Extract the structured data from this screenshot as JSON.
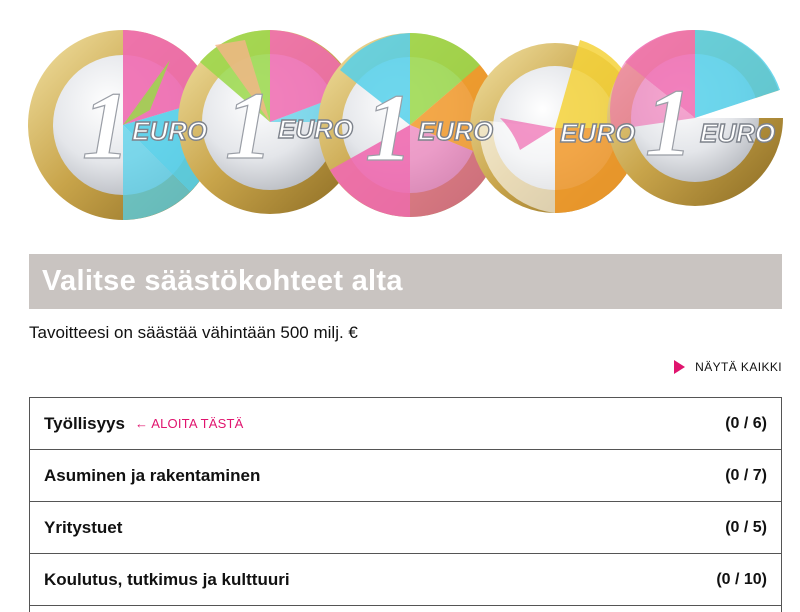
{
  "header": {
    "title": "Valitse säästökohteet alta",
    "subtitle": "Tavoitteesi on säästää vähintään 500 milj. €"
  },
  "show_all": {
    "label": "NÄYTÄ KAIKKI",
    "icon": "triangle-right-icon"
  },
  "coins": {
    "label": "EURO",
    "numeral": "1",
    "count": 5
  },
  "categories": [
    {
      "title": "Työllisyys",
      "hint": "← ALOITA TÄSTÄ",
      "count": "(0 / 6)"
    },
    {
      "title": "Asuminen ja rakentaminen",
      "hint": "",
      "count": "(0 / 7)"
    },
    {
      "title": "Yritystuet",
      "hint": "",
      "count": "(0 / 5)"
    },
    {
      "title": "Koulutus, tutkimus ja kulttuuri",
      "hint": "",
      "count": "(0 / 10)"
    }
  ],
  "colors": {
    "accent": "#e0146e",
    "banner": "#c9c4c1",
    "coin_pink": "#f06ab0",
    "coin_cyan": "#55d0ea",
    "coin_green": "#9ad84a",
    "coin_orange": "#f39a2a",
    "coin_yellow": "#f4d23a"
  }
}
